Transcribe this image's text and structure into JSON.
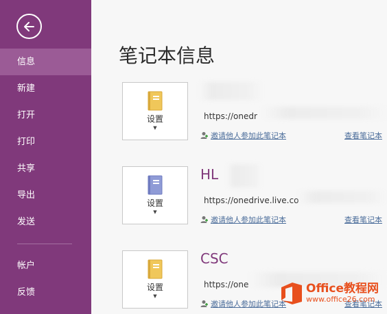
{
  "sidebar": {
    "items": [
      {
        "label": "信息",
        "active": true
      },
      {
        "label": "新建"
      },
      {
        "label": "打开"
      },
      {
        "label": "打印"
      },
      {
        "label": "共享"
      },
      {
        "label": "导出"
      },
      {
        "label": "发送"
      }
    ],
    "bottom_items": [
      {
        "label": "帐户"
      },
      {
        "label": "反馈"
      }
    ]
  },
  "main": {
    "title": "笔记本信息",
    "notebooks": [
      {
        "name": "",
        "url": "https://onedr",
        "settings_label": "设置",
        "invite_label": "邀请他人参加此笔记本",
        "view_label": "查看笔记本",
        "icon_color": "#f0c75a"
      },
      {
        "name": "HL",
        "url": "https://onedrive.live.co",
        "settings_label": "设置",
        "invite_label": "邀请他人参加此笔记本",
        "view_label": "查看笔记本",
        "icon_color": "#8f9bd6"
      },
      {
        "name": "CSC",
        "url": "https://one",
        "settings_label": "设置",
        "invite_label": "邀请他人参加此笔记本",
        "view_label": "查看笔记本",
        "icon_color": "#f0c75a"
      }
    ]
  },
  "watermark": {
    "title": "Office教程网",
    "url": "www.office26.com"
  },
  "colors": {
    "sidebar_bg": "#80397b",
    "sidebar_active": "#9b5b96",
    "accent": "#80397b",
    "link": "#4a6c9a"
  }
}
